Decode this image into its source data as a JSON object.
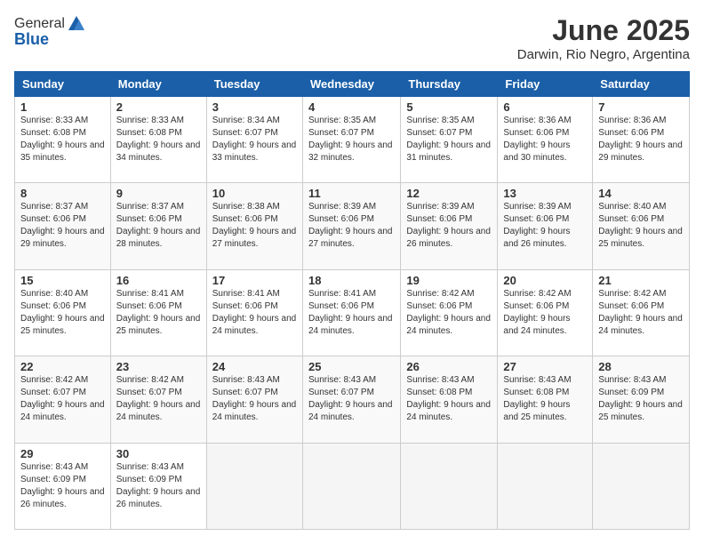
{
  "header": {
    "logo_general": "General",
    "logo_blue": "Blue",
    "main_title": "June 2025",
    "sub_title": "Darwin, Rio Negro, Argentina"
  },
  "columns": [
    "Sunday",
    "Monday",
    "Tuesday",
    "Wednesday",
    "Thursday",
    "Friday",
    "Saturday"
  ],
  "weeks": [
    [
      {
        "day": "1",
        "sunrise": "8:33 AM",
        "sunset": "6:08 PM",
        "daylight": "9 hours and 35 minutes."
      },
      {
        "day": "2",
        "sunrise": "8:33 AM",
        "sunset": "6:08 PM",
        "daylight": "9 hours and 34 minutes."
      },
      {
        "day": "3",
        "sunrise": "8:34 AM",
        "sunset": "6:07 PM",
        "daylight": "9 hours and 33 minutes."
      },
      {
        "day": "4",
        "sunrise": "8:35 AM",
        "sunset": "6:07 PM",
        "daylight": "9 hours and 32 minutes."
      },
      {
        "day": "5",
        "sunrise": "8:35 AM",
        "sunset": "6:07 PM",
        "daylight": "9 hours and 31 minutes."
      },
      {
        "day": "6",
        "sunrise": "8:36 AM",
        "sunset": "6:06 PM",
        "daylight": "9 hours and 30 minutes."
      },
      {
        "day": "7",
        "sunrise": "8:36 AM",
        "sunset": "6:06 PM",
        "daylight": "9 hours and 29 minutes."
      }
    ],
    [
      {
        "day": "8",
        "sunrise": "8:37 AM",
        "sunset": "6:06 PM",
        "daylight": "9 hours and 29 minutes."
      },
      {
        "day": "9",
        "sunrise": "8:37 AM",
        "sunset": "6:06 PM",
        "daylight": "9 hours and 28 minutes."
      },
      {
        "day": "10",
        "sunrise": "8:38 AM",
        "sunset": "6:06 PM",
        "daylight": "9 hours and 27 minutes."
      },
      {
        "day": "11",
        "sunrise": "8:39 AM",
        "sunset": "6:06 PM",
        "daylight": "9 hours and 27 minutes."
      },
      {
        "day": "12",
        "sunrise": "8:39 AM",
        "sunset": "6:06 PM",
        "daylight": "9 hours and 26 minutes."
      },
      {
        "day": "13",
        "sunrise": "8:39 AM",
        "sunset": "6:06 PM",
        "daylight": "9 hours and 26 minutes."
      },
      {
        "day": "14",
        "sunrise": "8:40 AM",
        "sunset": "6:06 PM",
        "daylight": "9 hours and 25 minutes."
      }
    ],
    [
      {
        "day": "15",
        "sunrise": "8:40 AM",
        "sunset": "6:06 PM",
        "daylight": "9 hours and 25 minutes."
      },
      {
        "day": "16",
        "sunrise": "8:41 AM",
        "sunset": "6:06 PM",
        "daylight": "9 hours and 25 minutes."
      },
      {
        "day": "17",
        "sunrise": "8:41 AM",
        "sunset": "6:06 PM",
        "daylight": "9 hours and 24 minutes."
      },
      {
        "day": "18",
        "sunrise": "8:41 AM",
        "sunset": "6:06 PM",
        "daylight": "9 hours and 24 minutes."
      },
      {
        "day": "19",
        "sunrise": "8:42 AM",
        "sunset": "6:06 PM",
        "daylight": "9 hours and 24 minutes."
      },
      {
        "day": "20",
        "sunrise": "8:42 AM",
        "sunset": "6:06 PM",
        "daylight": "9 hours and 24 minutes."
      },
      {
        "day": "21",
        "sunrise": "8:42 AM",
        "sunset": "6:06 PM",
        "daylight": "9 hours and 24 minutes."
      }
    ],
    [
      {
        "day": "22",
        "sunrise": "8:42 AM",
        "sunset": "6:07 PM",
        "daylight": "9 hours and 24 minutes."
      },
      {
        "day": "23",
        "sunrise": "8:42 AM",
        "sunset": "6:07 PM",
        "daylight": "9 hours and 24 minutes."
      },
      {
        "day": "24",
        "sunrise": "8:43 AM",
        "sunset": "6:07 PM",
        "daylight": "9 hours and 24 minutes."
      },
      {
        "day": "25",
        "sunrise": "8:43 AM",
        "sunset": "6:07 PM",
        "daylight": "9 hours and 24 minutes."
      },
      {
        "day": "26",
        "sunrise": "8:43 AM",
        "sunset": "6:08 PM",
        "daylight": "9 hours and 24 minutes."
      },
      {
        "day": "27",
        "sunrise": "8:43 AM",
        "sunset": "6:08 PM",
        "daylight": "9 hours and 25 minutes."
      },
      {
        "day": "28",
        "sunrise": "8:43 AM",
        "sunset": "6:09 PM",
        "daylight": "9 hours and 25 minutes."
      }
    ],
    [
      {
        "day": "29",
        "sunrise": "8:43 AM",
        "sunset": "6:09 PM",
        "daylight": "9 hours and 26 minutes."
      },
      {
        "day": "30",
        "sunrise": "8:43 AM",
        "sunset": "6:09 PM",
        "daylight": "9 hours and 26 minutes."
      },
      null,
      null,
      null,
      null,
      null
    ]
  ]
}
